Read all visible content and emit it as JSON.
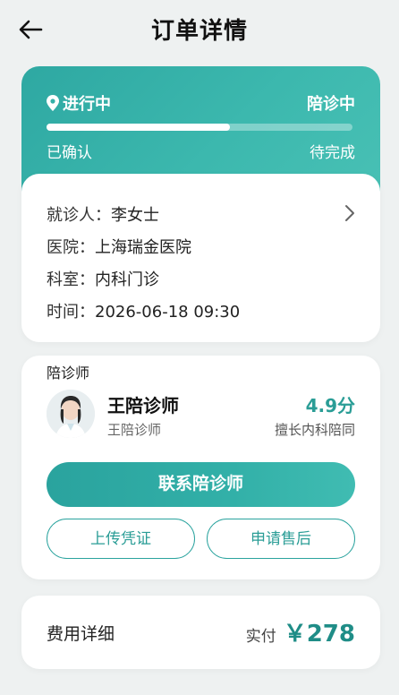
{
  "header": {
    "title": "订单详情"
  },
  "status": {
    "left_label": "进行中",
    "right_label": "陪诊中",
    "progress": 0.6,
    "step_left": "已确认",
    "step_right": "待完成"
  },
  "info": {
    "patient": {
      "key": "就诊人：",
      "value": "李女士"
    },
    "hospital": {
      "key": "医院：",
      "value": "上海瑞金医院"
    },
    "department": {
      "key": "科室：",
      "value": "内科门诊"
    },
    "time": {
      "key": "时间：",
      "value": "2026-06-18 09:30"
    }
  },
  "companion": {
    "section_label": "陪诊师",
    "name": "王陪诊师",
    "subtitle": "王陪诊师",
    "rating": "4.9分",
    "specialty": "擅长内科陪同",
    "contact_label": "联系陪诊师",
    "upload_label": "上传凭证",
    "aftersale_label": "申请售后"
  },
  "fee": {
    "label": "费用详细",
    "paid_label": "实付",
    "amount": "￥278"
  },
  "colors": {
    "accent": "#2ea8a2",
    "accent_text": "#2a9d96"
  }
}
